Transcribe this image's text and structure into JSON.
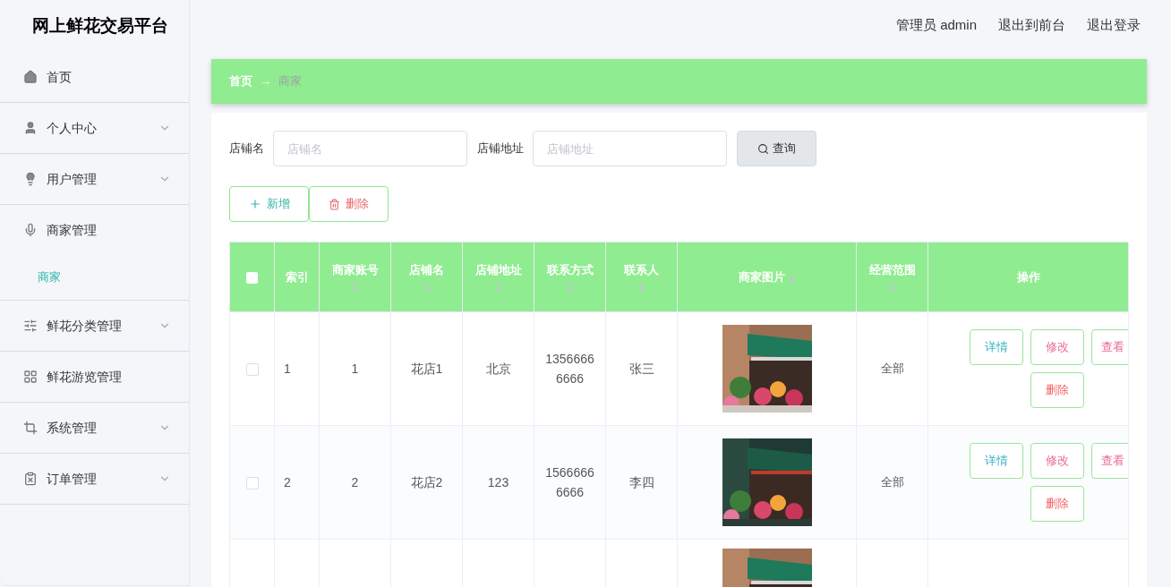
{
  "header": {
    "title": "网上鲜花交易平台",
    "links": [
      "管理员 admin",
      "退出到前台",
      "退出登录"
    ]
  },
  "sidebar": {
    "items": [
      {
        "label": "首页",
        "expandable": false
      },
      {
        "label": "个人中心",
        "expandable": true,
        "expanded": false
      },
      {
        "label": "用户管理",
        "expandable": true,
        "expanded": false
      },
      {
        "label": "商家管理",
        "expandable": false,
        "expanded": true,
        "children": [
          {
            "label": "商家",
            "selected": true
          }
        ]
      },
      {
        "label": "鲜花分类管理",
        "expandable": true,
        "expanded": false
      },
      {
        "label": "鲜花游览管理",
        "expandable": false
      },
      {
        "label": "系统管理",
        "expandable": true,
        "expanded": false
      },
      {
        "label": "订单管理",
        "expandable": true,
        "expanded": false
      }
    ]
  },
  "breadcrumb": [
    {
      "label": "首页",
      "current": false
    },
    {
      "label": "→",
      "current": false
    },
    {
      "label": "商家",
      "current": true
    }
  ],
  "search": {
    "fields": [
      {
        "label": "店铺名",
        "placeholder": "店铺名"
      },
      {
        "label": "店铺地址",
        "placeholder": "店铺地址"
      }
    ],
    "button": "查询"
  },
  "actions": [
    {
      "label": "新增",
      "kind": "add"
    },
    {
      "label": "删除",
      "kind": "delete"
    }
  ],
  "table": {
    "select_all_checked": false,
    "columns": [
      {
        "label": "索引",
        "sortable": false
      },
      {
        "label": "商家账号",
        "sortable": true
      },
      {
        "label": "店铺名",
        "sortable": true
      },
      {
        "label": "店铺地址",
        "sortable": true
      },
      {
        "label": "联系方式",
        "sortable": true
      },
      {
        "label": "联系人",
        "sortable": true
      },
      {
        "label": "商家图片",
        "sortable": true
      },
      {
        "label": "经营范围",
        "sortable": true
      },
      {
        "label": "操作",
        "sortable": false
      }
    ],
    "rows": [
      {
        "checked": false,
        "cells": [
          "1",
          "1",
          "花店1",
          "北京",
          "13566666666",
          "张三"
        ],
        "scope": "全部",
        "actions": [
          {
            "label": "详情",
            "kind": "info"
          },
          {
            "label": "修改",
            "kind": "edit"
          },
          {
            "label": "查看",
            "kind": "view"
          },
          {
            "label": "删除",
            "kind": "delete"
          }
        ]
      },
      {
        "checked": false,
        "cells": [
          "2",
          "2",
          "花店2",
          "123",
          "15666666666",
          "李四"
        ],
        "scope": "全部",
        "actions": [
          {
            "label": "详情",
            "kind": "info"
          },
          {
            "label": "修改",
            "kind": "edit"
          },
          {
            "label": "查看",
            "kind": "view"
          },
          {
            "label": "删除",
            "kind": "delete"
          }
        ]
      }
    ],
    "partial_row_below": true
  }
}
